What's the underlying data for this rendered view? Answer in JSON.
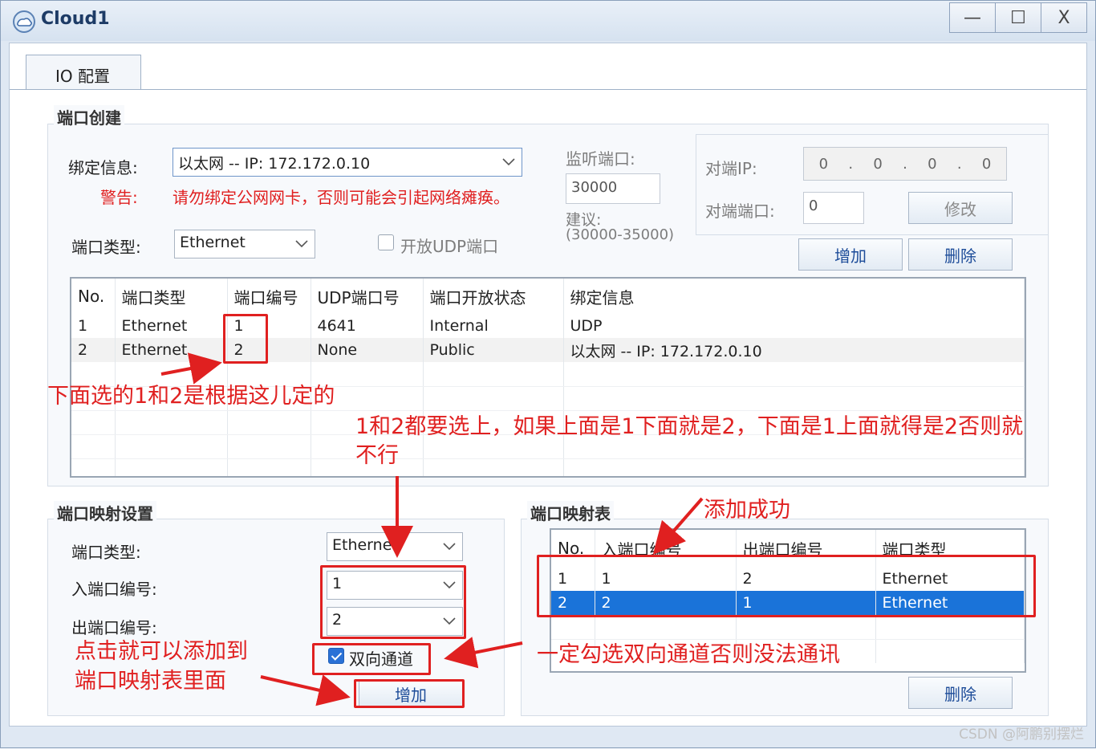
{
  "window": {
    "title": "Cloud1",
    "controls": {
      "minimize": "—",
      "maximize": "☐",
      "close": "X"
    }
  },
  "tabs": [
    {
      "label": "IO 配置",
      "active": true
    }
  ],
  "port_create": {
    "group_title": "端口创建",
    "bind_label": "绑定信息:",
    "bind_value": "以太网 -- IP: 172.172.0.10",
    "warning_label": "警告:",
    "warning_text": "请勿绑定公网网卡，否则可能会引起网络瘫痪。",
    "port_type_label": "端口类型:",
    "port_type_value": "Ethernet",
    "open_udp_label": "开放UDP端口",
    "open_udp_checked": false,
    "listen_port_label": "监听端口:",
    "listen_port_value": "30000",
    "suggest_label": "建议:",
    "suggest_range": "(30000-35000)",
    "peer_ip_label": "对端IP:",
    "peer_ip_octets": [
      "0",
      "0",
      "0",
      "0"
    ],
    "peer_port_label": "对端端口:",
    "peer_port_value": "0",
    "modify_button": "修改",
    "add_button": "增加",
    "delete_button": "删除",
    "table": {
      "columns": [
        "No.",
        "端口类型",
        "端口编号",
        "UDP端口号",
        "端口开放状态",
        "绑定信息"
      ],
      "rows": [
        [
          "1",
          "Ethernet",
          "1",
          "4641",
          "Internal",
          "UDP"
        ],
        [
          "2",
          "Ethernet",
          "2",
          "None",
          "Public",
          "以太网 -- IP: 172.172.0.10"
        ]
      ]
    }
  },
  "port_mapping_settings": {
    "group_title": "端口映射设置",
    "port_type_label": "端口类型:",
    "port_type_value": "Ethernet",
    "in_port_label": "入端口编号:",
    "in_port_value": "1",
    "out_port_label": "出端口编号:",
    "out_port_value": "2",
    "bidirectional_label": "双向通道",
    "bidirectional_checked": true,
    "add_button": "增加"
  },
  "port_mapping_table": {
    "group_title": "端口映射表",
    "columns": [
      "No.",
      "入端口编号",
      "出端口编号",
      "端口类型"
    ],
    "rows": [
      [
        "1",
        "1",
        "2",
        "Ethernet"
      ],
      [
        "2",
        "2",
        "1",
        "Ethernet"
      ]
    ],
    "selected_row": 2,
    "delete_button": "删除"
  },
  "annotations": {
    "note_numbering": "下面选的1和2是根据这儿定的",
    "note_select_both_line1": "1和2都要选上，如果上面是1下面就是2，下面是1上面就得是2否则就",
    "note_select_both_line2": "不行",
    "note_success": "添加成功",
    "note_bidirectional": "一定勾选双向通道否则没法通讯",
    "note_click_line1": "点击就可以添加到",
    "note_click_line2": "端口映射表里面",
    "color": "#e02020"
  },
  "watermark": "CSDN @阿鹏别摆烂"
}
